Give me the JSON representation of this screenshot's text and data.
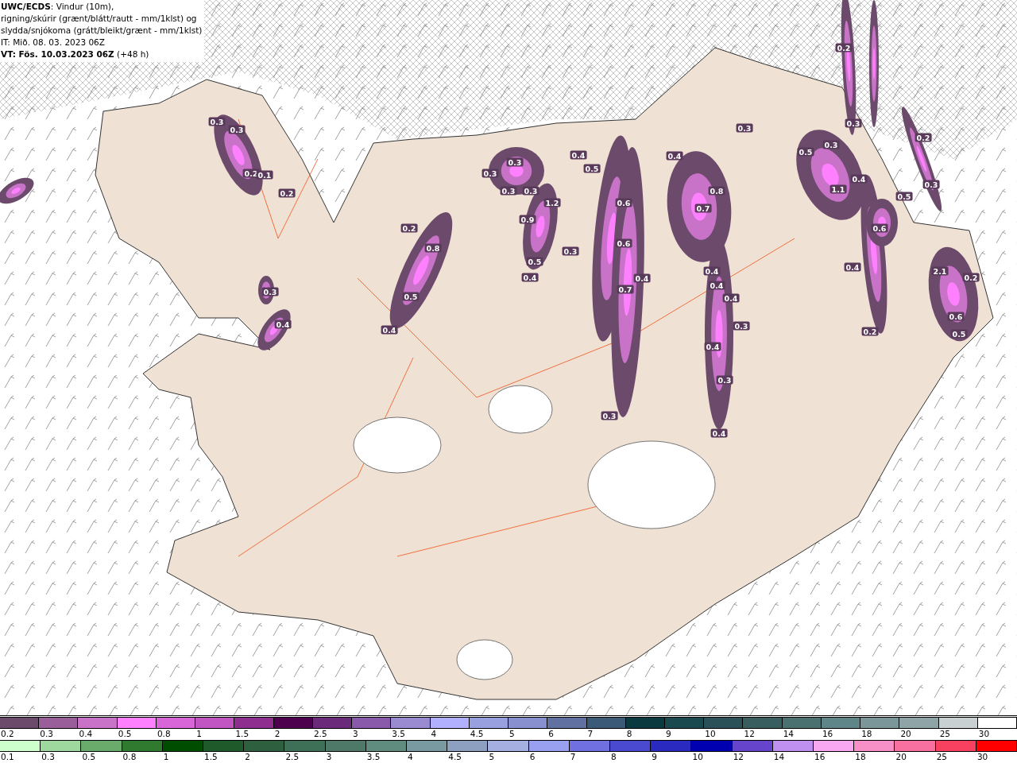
{
  "info_box": {
    "lines": [
      "**UWC/ECDS**: Vindur (10m),",
      "rigning/skúrir (grænt/blátt/rautt - mm/1klst) og",
      "slydda/snjókoma (grátt/bleikt/grænt - mm/1klst)",
      "IT: Mið. 08. 03. 2023 06Z",
      "**VT: Fös. 10.03.2023 06Z** (+48 h)"
    ]
  },
  "map_labels": [
    "0.3",
    "0.3",
    "0.2",
    "0.1",
    "0.2",
    "0.2",
    "0.8",
    "0.5",
    "0.4",
    "0.3",
    "0.4",
    "0.3",
    "0.3",
    "0.3",
    "0.3",
    "1.2",
    "0.9",
    "0.5",
    "0.4",
    "0.3",
    "0.4",
    "0.5",
    "0.6",
    "0.6",
    "0.7",
    "0.4",
    "0.3",
    "0.4",
    "0.8",
    "0.7",
    "0.4",
    "0.4",
    "0.4",
    "0.3",
    "0.4",
    "0.3",
    "0.4",
    "0.3",
    "0.5",
    "0.3",
    "0.3",
    "1.1",
    "0.4",
    "0.5",
    "0.6",
    "0.4",
    "2.1",
    "0.2",
    "0.6",
    "0.5",
    "0.3",
    "0.2",
    "0.2",
    "0.2"
  ],
  "legend_sleet": [
    {
      "label": "0.2",
      "color": "#6b4a6b"
    },
    {
      "label": "0.3",
      "color": "#9a5e9a"
    },
    {
      "label": "0.4",
      "color": "#c873c8"
    },
    {
      "label": "0.5",
      "color": "#ff80ff"
    },
    {
      "label": "0.8",
      "color": "#d966d9"
    },
    {
      "label": "1",
      "color": "#c155c1"
    },
    {
      "label": "1.5",
      "color": "#8e2e8e"
    },
    {
      "label": "2",
      "color": "#4d004d"
    },
    {
      "label": "2.5",
      "color": "#6b2b7a"
    },
    {
      "label": "3",
      "color": "#8a5aaa"
    },
    {
      "label": "3.5",
      "color": "#9a8ad0"
    },
    {
      "label": "4",
      "color": "#b0b0ff"
    },
    {
      "label": "4.5",
      "color": "#98a0e0"
    },
    {
      "label": "5",
      "color": "#8890d0"
    },
    {
      "label": "6",
      "color": "#6070a0"
    },
    {
      "label": "7",
      "color": "#3a5a78"
    },
    {
      "label": "8",
      "color": "#0a3a40"
    },
    {
      "label": "9",
      "color": "#1a4a50"
    },
    {
      "label": "10",
      "color": "#2a5058"
    },
    {
      "label": "12",
      "color": "#385e60"
    },
    {
      "label": "14",
      "color": "#4a7070"
    },
    {
      "label": "16",
      "color": "#5e8588"
    },
    {
      "label": "18",
      "color": "#7a9698"
    },
    {
      "label": "20",
      "color": "#8ea4a6"
    },
    {
      "label": "25",
      "color": "#c8d0d2"
    },
    {
      "label": "30",
      "color": "#ffffff"
    }
  ],
  "legend_rain": [
    {
      "label": "0.1",
      "color": "#ccffcc"
    },
    {
      "label": "0.3",
      "color": "#9ed89e"
    },
    {
      "label": "0.5",
      "color": "#6aaa6a"
    },
    {
      "label": "0.8",
      "color": "#307a30"
    },
    {
      "label": "1",
      "color": "#004d00"
    },
    {
      "label": "1.5",
      "color": "#1e5a2a"
    },
    {
      "label": "2",
      "color": "#2e6040"
    },
    {
      "label": "2.5",
      "color": "#3e7058"
    },
    {
      "label": "3",
      "color": "#4e7868"
    },
    {
      "label": "3.5",
      "color": "#608c80"
    },
    {
      "label": "4",
      "color": "#7a9aa2"
    },
    {
      "label": "4.5",
      "color": "#8ea0c0"
    },
    {
      "label": "5",
      "color": "#a6b0e0"
    },
    {
      "label": "6",
      "color": "#9aa0f0"
    },
    {
      "label": "7",
      "color": "#7070e0"
    },
    {
      "label": "8",
      "color": "#4a4ad0"
    },
    {
      "label": "9",
      "color": "#2a2ac0"
    },
    {
      "label": "10",
      "color": "#0000b0"
    },
    {
      "label": "12",
      "color": "#6644cc"
    },
    {
      "label": "14",
      "color": "#c090f0"
    },
    {
      "label": "16",
      "color": "#f8a8f0"
    },
    {
      "label": "18",
      "color": "#f890c8"
    },
    {
      "label": "20",
      "color": "#f870a0"
    },
    {
      "label": "25",
      "color": "#f84060"
    },
    {
      "label": "30",
      "color": "#ff0000"
    }
  ]
}
